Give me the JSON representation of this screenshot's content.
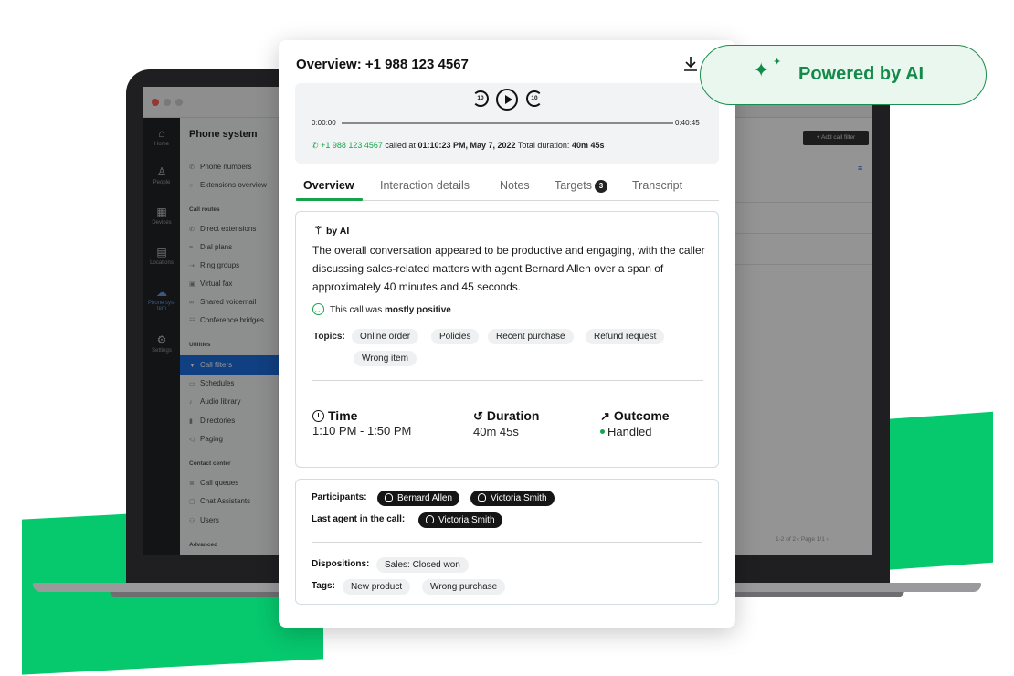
{
  "brand": {
    "accent": "#17a34a",
    "green_bg": "#06c86d"
  },
  "app": {
    "rail": [
      {
        "label": "Home",
        "icon": "home-icon"
      },
      {
        "label": "People",
        "icon": "person-icon"
      },
      {
        "label": "Devices",
        "icon": "devices-icon"
      },
      {
        "label": "Locations",
        "icon": "building-icon"
      },
      {
        "label": "Phone sys-tem",
        "icon": "cloud-icon"
      },
      {
        "label": "Settings",
        "icon": "gear-icon"
      }
    ],
    "sidebar": {
      "title": "Phone system",
      "items": [
        "Phone numbers",
        "Extensions overview",
        "Direct extensions",
        "Dial plans",
        "Ring groups",
        "Virtual fax",
        "Shared voicemail",
        "Conference bridges",
        "Call filters",
        "Schedules",
        "Audio library",
        "Directories",
        "Paging",
        "Call queues",
        "Chat Assistants",
        "Users"
      ],
      "headings": [
        "Call routes",
        "Utilities",
        "Contact center",
        "Advanced"
      ]
    },
    "add_filter": "+ Add call filter",
    "pager": "1-2 of 2   ‹   Page 1/1   ›"
  },
  "card": {
    "title": "Overview: +1 988 123 4567",
    "player": {
      "start": "0:00:00",
      "end": "0:40:45",
      "rewind": "10",
      "forward": "10",
      "progress": 0.0
    },
    "call": {
      "number": "+1 988 123 4567",
      "called_at": "called at",
      "time": "01:10:23 PM, May 7, 2022",
      "duration_label": "Total duration:",
      "duration": "40m 45s"
    },
    "tabs": [
      "Overview",
      "Interaction details",
      "Notes",
      "Targets",
      "Transcript"
    ],
    "targets_count": "3",
    "ai_label": "by AI",
    "summary": "The overall conversation appeared to be productive and engaging, with the caller discussing sales-related matters with agent Bernard Allen over a span of approximately 40 minutes and 45 seconds.",
    "sentiment_prefix": "This call was",
    "sentiment_value": "mostly positive",
    "topics_label": "Topics:",
    "topics": [
      "Online order",
      "Policies",
      "Recent purchase",
      "Refund request",
      "Wrong item"
    ],
    "stats": {
      "time_label": "Time",
      "time_value": "1:10 PM - 1:50 PM",
      "duration_label": "Duration",
      "duration_value": "40m 45s",
      "outcome_label": "Outcome",
      "outcome_value": "Handled"
    },
    "participants_label": "Participants:",
    "participants": [
      "Bernard Allen",
      "Victoria Smith"
    ],
    "last_agent_label": "Last agent in the call:",
    "last_agent": "Victoria Smith",
    "dispositions_label": "Dispositions:",
    "dispositions": [
      "Sales: Closed won"
    ],
    "tags_label": "Tags:",
    "tags": [
      "New product",
      "Wrong purchase"
    ]
  },
  "pill": {
    "text": "Powered by AI"
  }
}
